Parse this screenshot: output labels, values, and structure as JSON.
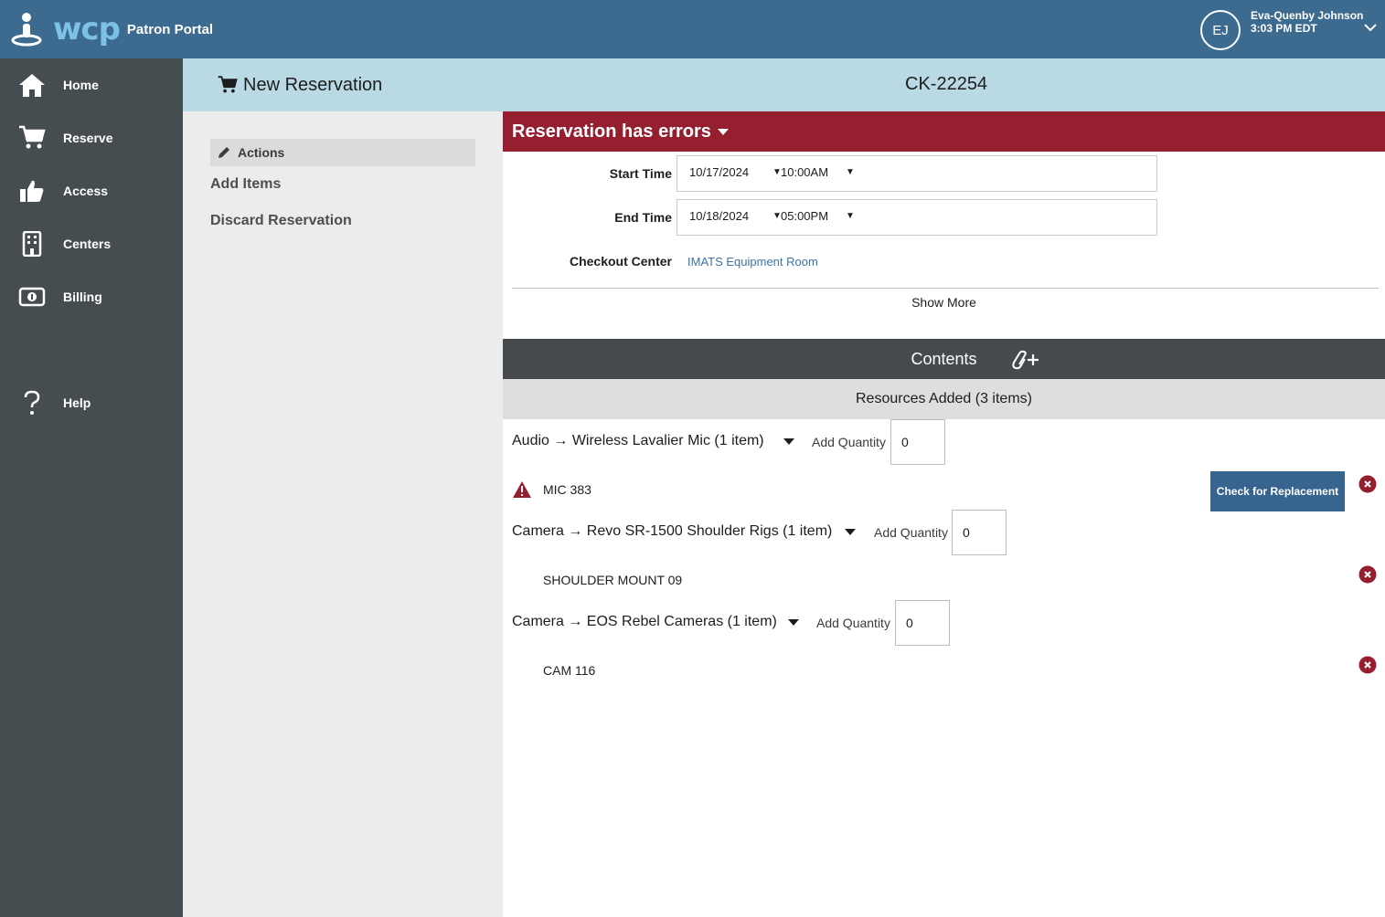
{
  "brand": {
    "logo_text": "wcp",
    "portal_label": "Patron Portal"
  },
  "user": {
    "initials": "EJ",
    "name": "Eva-Quenby Johnson",
    "time": "3:03 PM EDT"
  },
  "sidebar": {
    "items": [
      {
        "label": "Home",
        "icon": "home-icon"
      },
      {
        "label": "Reserve",
        "icon": "cart-icon"
      },
      {
        "label": "Access",
        "icon": "thumbs-up-icon"
      },
      {
        "label": "Centers",
        "icon": "building-icon"
      },
      {
        "label": "Billing",
        "icon": "money-icon"
      },
      {
        "label": "Help",
        "icon": "question-icon"
      }
    ]
  },
  "header": {
    "title": "New Reservation",
    "reservation_id": "CK-22254"
  },
  "actions": {
    "heading": "Actions",
    "add_items": "Add Items",
    "discard": "Discard Reservation"
  },
  "errors": {
    "label": "Reservation has errors",
    "color": "#961f2f"
  },
  "reservation": {
    "start_label": "Start Time",
    "start_date": "10/17/2024",
    "start_time": "10:00AM",
    "end_label": "End Time",
    "end_date": "10/18/2024",
    "end_time": "05:00PM",
    "center_label": "Checkout Center",
    "center_value": "IMATS Equipment Room",
    "show_more": "Show More"
  },
  "contents": {
    "title": "Contents",
    "resources_label": "Resources Added (3 items)",
    "qty_label": "Add Quantity",
    "replace_button": "Check for Replacement",
    "groups": [
      {
        "title": "Audio → Wireless Lavalier Mic (1 item)",
        "qty": "0",
        "items": [
          "MIC 383"
        ],
        "has_error": true
      },
      {
        "title": "Camera → Revo SR-1500 Shoulder Rigs (1 item)",
        "qty": "0",
        "items": [
          "SHOULDER MOUNT 09"
        ],
        "has_error": false
      },
      {
        "title": "Camera → EOS Rebel Cameras (1 item)",
        "qty": "0",
        "items": [
          "CAM 116"
        ],
        "has_error": false
      }
    ]
  },
  "colors": {
    "topbar": "#3d6a8f",
    "sidebar": "#464d51",
    "header_band": "#b9d9e5",
    "button": "#386590",
    "error": "#961f2f"
  }
}
